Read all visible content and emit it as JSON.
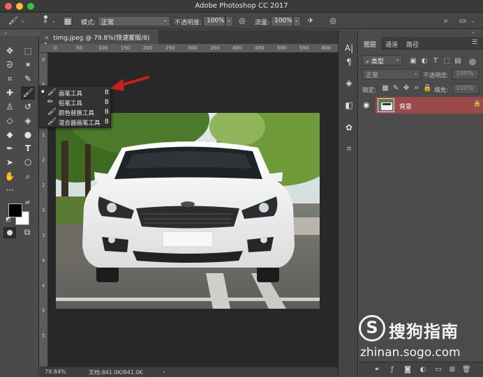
{
  "window": {
    "title": "Adobe Photoshop CC 2017"
  },
  "options_bar": {
    "brush_size": "8",
    "mode_label": "模式:",
    "mode_value": "正常",
    "opacity_label": "不透明度:",
    "opacity_value": "100%",
    "flow_label": "流量:",
    "flow_value": "100%"
  },
  "document": {
    "tab_title": "timg.jpeg @ 79.8%(快速蒙版/8) *",
    "close_glyph": "×",
    "ruler_h_ticks": [
      "0",
      "50",
      "100",
      "150",
      "200",
      "250",
      "300",
      "350",
      "400",
      "450",
      "500",
      "550",
      "600"
    ],
    "ruler_v_ticks": [
      "0",
      "5",
      "1",
      "1",
      "2",
      "2",
      "3",
      "3",
      "4",
      "4",
      "5",
      "5"
    ]
  },
  "status_bar": {
    "zoom": "79.84%",
    "doc_info": "文档:841.0K/841.0K",
    "arrow": "›"
  },
  "brush_flyout": {
    "items": [
      {
        "label": "画笔工具",
        "shortcut": "B",
        "active": true
      },
      {
        "label": "铅笔工具",
        "shortcut": "B",
        "active": false
      },
      {
        "label": "颜色替换工具",
        "shortcut": "B",
        "active": false
      },
      {
        "label": "混合器画笔工具",
        "shortcut": "B",
        "active": false
      }
    ]
  },
  "layers_panel": {
    "tabs": [
      "图层",
      "通道",
      "路径"
    ],
    "filter_kind": "类型",
    "blend_mode": "正常",
    "opacity_label": "不透明度:",
    "opacity_value": "100%",
    "lock_label": "锁定:",
    "fill_label": "填充:",
    "fill_value": "100%",
    "layers": [
      {
        "name": "背景",
        "locked": true,
        "visible": true
      }
    ]
  },
  "watermark": {
    "brand": "搜狗指南",
    "url": "zhinan.sogo.com"
  },
  "colors": {
    "accent_red": "#c4211d",
    "layer_selected": "#9b4a4a",
    "panel_bg": "#4b4b4b",
    "canvas_bg": "#282828"
  }
}
